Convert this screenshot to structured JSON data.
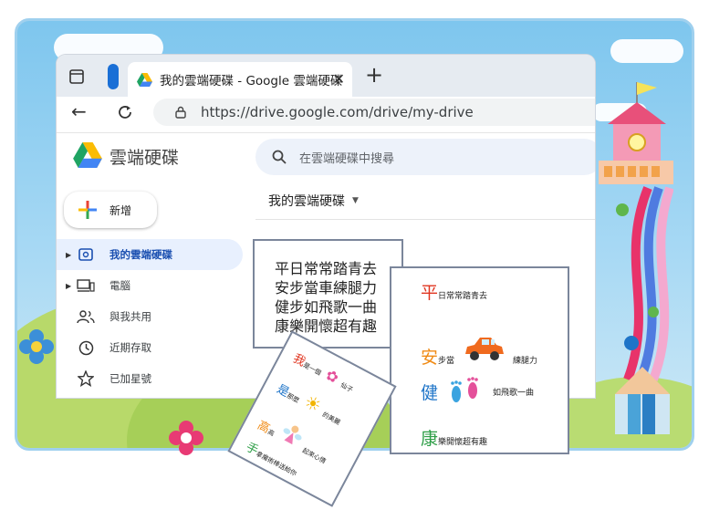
{
  "browser": {
    "tab_title": "我的雲端硬碟 - Google 雲端硬碟",
    "url": "https://drive.google.com/drive/my-drive"
  },
  "drive": {
    "app_name": "雲端硬碟",
    "search_placeholder": "在雲端硬碟中搜尋",
    "new_label": "新增",
    "breadcrumb": "我的雲端硬碟",
    "sidebar": [
      {
        "label": "我的雲端硬碟",
        "icon": "drive-icon"
      },
      {
        "label": "電腦",
        "icon": "computer-icon"
      },
      {
        "label": "與我共用",
        "icon": "people-icon"
      },
      {
        "label": "近期存取",
        "icon": "clock-icon"
      },
      {
        "label": "已加星號",
        "icon": "star-icon"
      }
    ]
  },
  "poem_card": {
    "lines": [
      "平日常常踏青去",
      "安步當車練腿力",
      "健步如飛歌一曲",
      "康樂開懷超有趣"
    ]
  },
  "right_card": {
    "rows": [
      {
        "big": "平",
        "rest": "日常常踏青去"
      },
      {
        "big": "安",
        "rest": "步當",
        "after": "練腿力"
      },
      {
        "big": "健",
        "after": "如飛歌一曲"
      },
      {
        "big": "康",
        "rest": "樂開懷超有趣"
      }
    ]
  },
  "tilted_card": {
    "rows": [
      {
        "big": "我",
        "rest": "是一個",
        "after": "仙子"
      },
      {
        "big": "是",
        "rest": "那麼",
        "after": "的美麗"
      },
      {
        "big": "高",
        "rest": "高",
        "after": "起來心情"
      },
      {
        "big": "手",
        "rest": "拿魔術棒送給你"
      }
    ]
  },
  "colors": {
    "accent": "#1a73e8",
    "frame": "#9fd0ee",
    "card_border": "#7b869b"
  }
}
